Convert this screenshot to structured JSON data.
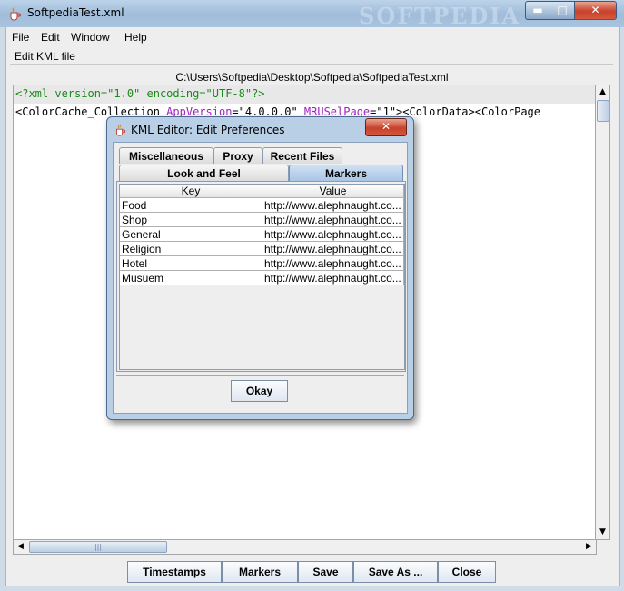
{
  "window": {
    "title": "SoftpediaTest.xml",
    "watermark": "SOFTPEDIA",
    "minimize_glyph": "▬",
    "maximize_glyph": "□",
    "close_glyph": "✕"
  },
  "menu": [
    "File",
    "Edit",
    "Window",
    "Help"
  ],
  "panel": {
    "label": "Edit KML file",
    "file_path": "C:\\Users\\Softpedia\\Desktop\\Softpedia\\SoftpediaTest.xml"
  },
  "editor": {
    "line1": "<?xml version=\"1.0\" encoding=\"UTF-8\"?>",
    "line2": {
      "tag": "<ColorCache_Collection ",
      "attr1_name": "AppVersion",
      "attr1_value": "=\"4.0.0.0\" ",
      "attr2_name": "MRUSelPage",
      "attr2_value": "=\"1\"><ColorData><ColorPage"
    }
  },
  "buttons": {
    "timestamps": "Timestamps",
    "markers": "Markers",
    "save": "Save",
    "save_as": "Save As ...",
    "close": "Close"
  },
  "dialog": {
    "title": "KML Editor: Edit Preferences",
    "close_glyph": "✕",
    "tabs": {
      "miscellaneous": "Miscellaneous",
      "proxy": "Proxy",
      "recent_files": "Recent Files",
      "look_and_feel": "Look and Feel",
      "markers": "Markers"
    },
    "selected_tab": "Markers",
    "table": {
      "columns": [
        "Key",
        "Value"
      ],
      "rows": [
        [
          "Food",
          "http://www.alephnaught.co..."
        ],
        [
          "Shop",
          "http://www.alephnaught.co..."
        ],
        [
          "General",
          "http://www.alephnaught.co..."
        ],
        [
          "Religion",
          "http://www.alephnaught.co..."
        ],
        [
          "Hotel",
          "http://www.alephnaught.co..."
        ],
        [
          "Musuem",
          "http://www.alephnaught.co..."
        ]
      ]
    },
    "okay_label": "Okay"
  },
  "colors": {
    "titlebar": "#a9c4df",
    "close_red": "#c8412b",
    "xml_decl_green": "#1a8a1a",
    "attr_purple": "#a020c0"
  },
  "icons": [
    "java-cup-icon",
    "scroll-up-arrow-icon",
    "scroll-down-arrow-icon",
    "scroll-left-arrow-icon",
    "scroll-right-arrow-icon"
  ]
}
